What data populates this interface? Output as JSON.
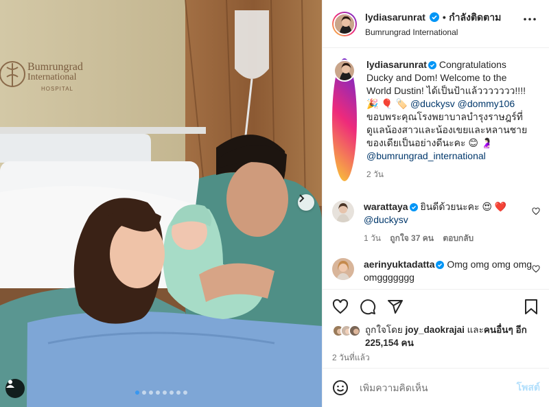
{
  "post": {
    "username": "lydiasarunrat",
    "follow_label": "กำลังติดตาม",
    "location": "Bumrungrad International",
    "hospital_sign": {
      "name_line1": "Bumrungrad",
      "name_line2": "International",
      "name_line3": "HOSPITAL"
    },
    "carousel": {
      "total": 8,
      "active_index": 0
    }
  },
  "caption": {
    "username": "lydiasarunrat",
    "text_1": "Congratulations Ducky and Dom! Welcome to the World Dustin! ได้เป็นป้าแล้ววววววว!!!! 🎉 🎈 🏷️",
    "mention_1": "@duckysv",
    "mention_2": "@dommy106",
    "text_2": "ขอบพระคุณโรงพยาบาลบำรุงราษฎร์ที่ดูแลน้องสาวและน้องเขยและหลานชาย ของเดียเป็นอย่างดีนะคะ 😊 🤰🏻",
    "mention_3": "@bumrungrad_international",
    "time": "2 วัน"
  },
  "comments": [
    {
      "username": "warattaya",
      "text": "ยินดีด้วยนะคะ 😍 ❤️",
      "mention": "@duckysv",
      "time": "1 วัน",
      "likes": "ถูกใจ 37 คน",
      "reply": "ตอบกลับ"
    },
    {
      "username": "aerinyuktadatta",
      "text": "Omg omg omg omg omggggggg"
    }
  ],
  "likes": {
    "prefix": "ถูกใจโดย",
    "user": "joy_daokrajai",
    "and": "และ",
    "others_label": "คนอื่นๆ",
    "count_text": "อีก 225,154 คน"
  },
  "post_time": "2 วันที่แล้ว",
  "add_comment": {
    "placeholder": "เพิ่มความคิดเห็น",
    "post_label": "โพสต์"
  },
  "colors": {
    "verified": "#0095f6",
    "mention": "#00376b",
    "post_button": "#b2dffc",
    "carousel_active": "#3897f0"
  }
}
